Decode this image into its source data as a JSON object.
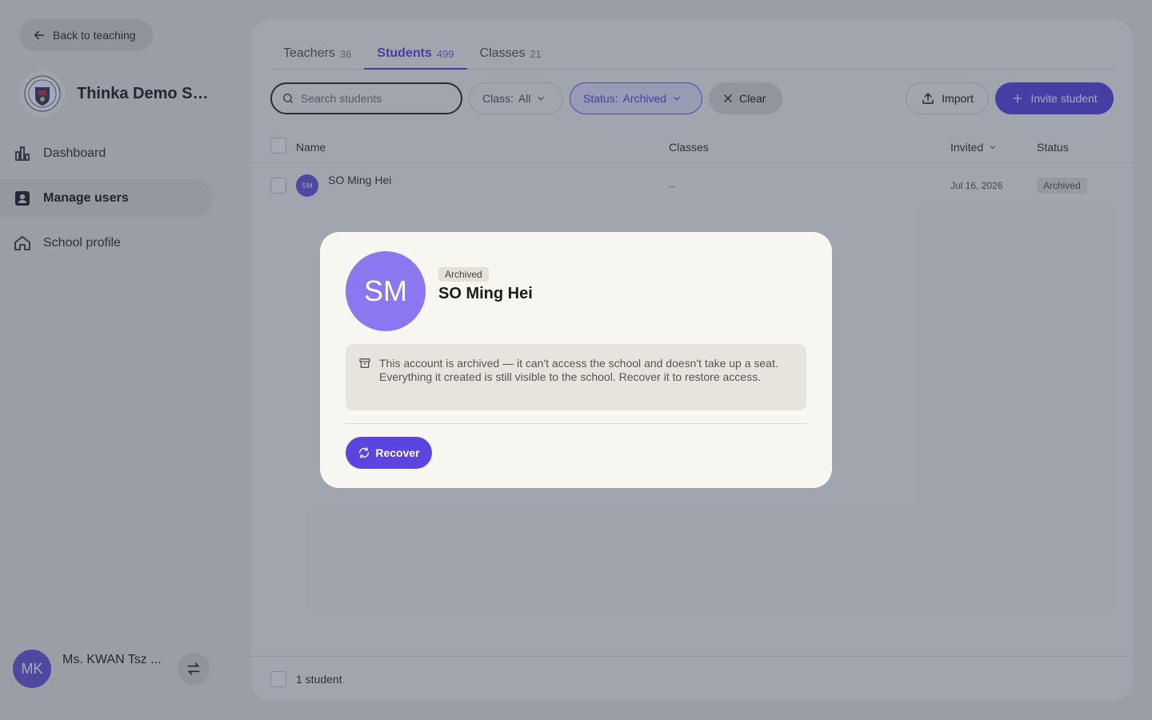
{
  "sidebar": {
    "back_label": "Back to teaching",
    "school_name": "Thinka Demo Se...",
    "nav": [
      {
        "label": "Dashboard",
        "icon": "bar-chart-icon"
      },
      {
        "label": "Manage users",
        "icon": "user-card-icon",
        "active": true
      },
      {
        "label": "School profile",
        "icon": "home-icon"
      }
    ],
    "user": {
      "initials": "MK",
      "name": "Ms. KWAN Tsz ..."
    }
  },
  "tabs": [
    {
      "label": "Teachers",
      "count": "36"
    },
    {
      "label": "Students",
      "count": "499",
      "active": true
    },
    {
      "label": "Classes",
      "count": "21"
    }
  ],
  "toolbar": {
    "search_placeholder": "Search students",
    "class_filter_label": "Class:",
    "class_filter_value": "All",
    "status_filter_label": "Status:",
    "status_filter_value": "Archived",
    "clear_label": "Clear",
    "import_label": "Import",
    "invite_label": "Invite student"
  },
  "table": {
    "columns": [
      "Name",
      "Classes",
      "Invited",
      "Status"
    ],
    "rows": [
      {
        "initials": "SM",
        "name": "SO Ming Hei",
        "classes": "–",
        "invited": "Jul 16, 2026",
        "status": "Archived"
      }
    ]
  },
  "footer": {
    "count_label": "1 student"
  },
  "modal": {
    "initials": "SM",
    "badge": "Archived",
    "name": "SO Ming Hei",
    "notice": "This account is archived — it can't access the school and doesn't take up a seat. Everything it created is still visible to the school. Recover it to restore access.",
    "recover_label": "Recover"
  },
  "colors": {
    "accent": "#5b45e0",
    "avatar": "#8b77f0",
    "background": "#eceae2"
  }
}
